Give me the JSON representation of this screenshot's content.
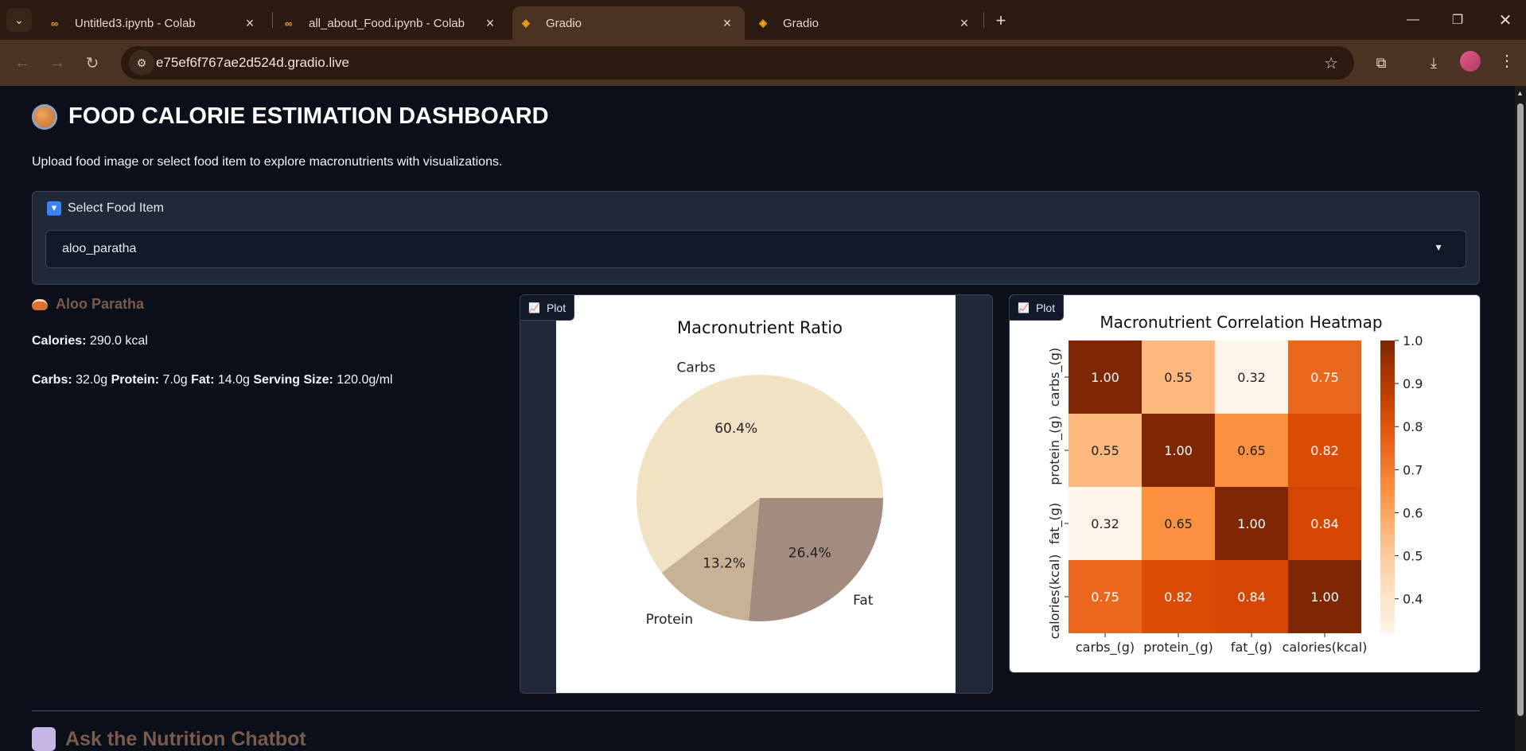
{
  "browser": {
    "tabs": [
      {
        "title": "Untitled3.ipynb - Colab",
        "favicon": "colab-icon"
      },
      {
        "title": "all_about_Food.ipynb - Colab",
        "favicon": "colab-icon"
      },
      {
        "title": "Gradio",
        "favicon": "gradio-icon",
        "active": true
      },
      {
        "title": "Gradio",
        "favicon": "gradio-icon"
      }
    ],
    "url": "e75ef6f767ae2d524d.gradio.live"
  },
  "app": {
    "title": "FOOD CALORIE ESTIMATION DASHBOARD",
    "subtitle": "Upload food image or select food item to explore macronutrients with visualizations."
  },
  "select": {
    "label": "Select Food Item",
    "value": "aloo_paratha"
  },
  "info": {
    "food_name": "Aloo Paratha",
    "calories_label": "Calories:",
    "calories_value": " 290.0 kcal",
    "carbs_label": "Carbs:",
    "carbs_value": " 32.0g ",
    "protein_label": "Protein:",
    "protein_value": " 7.0g ",
    "fat_label": "Fat:",
    "fat_value": " 14.0g ",
    "serving_label": "Serving Size:",
    "serving_value": " 120.0g/ml"
  },
  "plots": {
    "tag_label": "Plot"
  },
  "chatbot": {
    "title": "Ask the Nutrition Chatbot"
  },
  "colors": {
    "carbs": "#f2e2c4",
    "protein": "#c8b296",
    "fat": "#a38b7f"
  },
  "chart_data": [
    {
      "type": "pie",
      "title": "Macronutrient Ratio",
      "labels": [
        "Carbs",
        "Protein",
        "Fat"
      ],
      "values": [
        32.0,
        7.0,
        14.0
      ],
      "percent_labels": [
        "60.4%",
        "13.2%",
        "26.4%"
      ]
    },
    {
      "type": "heatmap",
      "title": "Macronutrient Correlation Heatmap",
      "xlabels": [
        "carbs_(g)",
        "protein_(g)",
        "fat_(g)",
        "calories(kcal)"
      ],
      "ylabels": [
        "carbs_(g)",
        "protein_(g)",
        "fat_(g)",
        "calories(kcal)"
      ],
      "values": [
        [
          1.0,
          0.55,
          0.32,
          0.75
        ],
        [
          0.55,
          1.0,
          0.65,
          0.82
        ],
        [
          0.32,
          0.65,
          1.0,
          0.84
        ],
        [
          0.75,
          0.82,
          0.84,
          1.0
        ]
      ],
      "cell_labels": [
        [
          "1.00",
          "0.55",
          "0.32",
          "0.75"
        ],
        [
          "0.55",
          "1.00",
          "0.65",
          "0.82"
        ],
        [
          "0.32",
          "0.65",
          "1.00",
          "0.84"
        ],
        [
          "0.75",
          "0.82",
          "0.84",
          "1.00"
        ]
      ],
      "colorbar_ticks": [
        1.0,
        0.9,
        0.8,
        0.7,
        0.6,
        0.5,
        0.4
      ],
      "colorbar_tick_labels": [
        "1.0",
        "0.9",
        "0.8",
        "0.7",
        "0.6",
        "0.5",
        "0.4"
      ],
      "colorbar_range": [
        0.32,
        1.0
      ],
      "colormap": "Oranges"
    }
  ]
}
